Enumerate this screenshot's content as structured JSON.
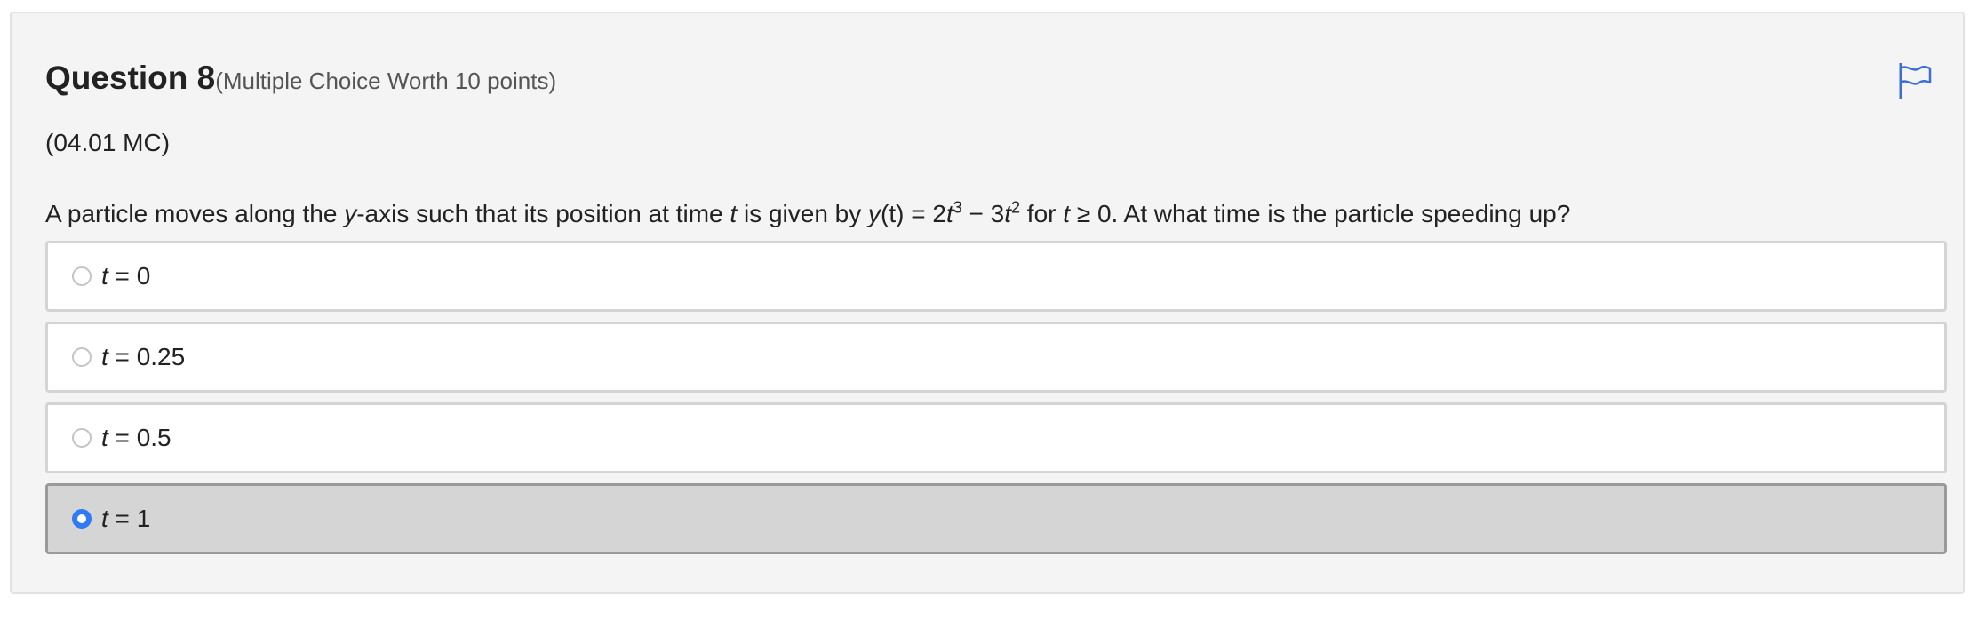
{
  "question": {
    "title": "Question 8",
    "meta": "(Multiple Choice Worth 10 points)",
    "code": "(04.01 MC)",
    "prompt": {
      "p1": "A particle moves along the ",
      "var_y": "y",
      "p2": "-axis such that its position at time ",
      "var_t": "t",
      "p3": " is given by ",
      "fn": "y",
      "p4": "(t) = 2",
      "t_a": "t",
      "exp3": "3",
      "p5": " − 3",
      "t_b": "t",
      "exp2": "2",
      "p6": " for ",
      "t_c": "t",
      "p7": " ≥ 0. At what time is the particle speeding up?"
    }
  },
  "flag": {
    "icon": "flag-icon",
    "color": "#3b6fd4"
  },
  "choices": [
    {
      "var": "t",
      "text": " = 0",
      "selected": false
    },
    {
      "var": "t",
      "text": " = 0.25",
      "selected": false
    },
    {
      "var": "t",
      "text": " = 0.5",
      "selected": false
    },
    {
      "var": "t",
      "text": " = 1",
      "selected": true
    }
  ],
  "colors": {
    "radio_selected": "#2f7af5",
    "selected_bg": "#d5d5d5"
  }
}
